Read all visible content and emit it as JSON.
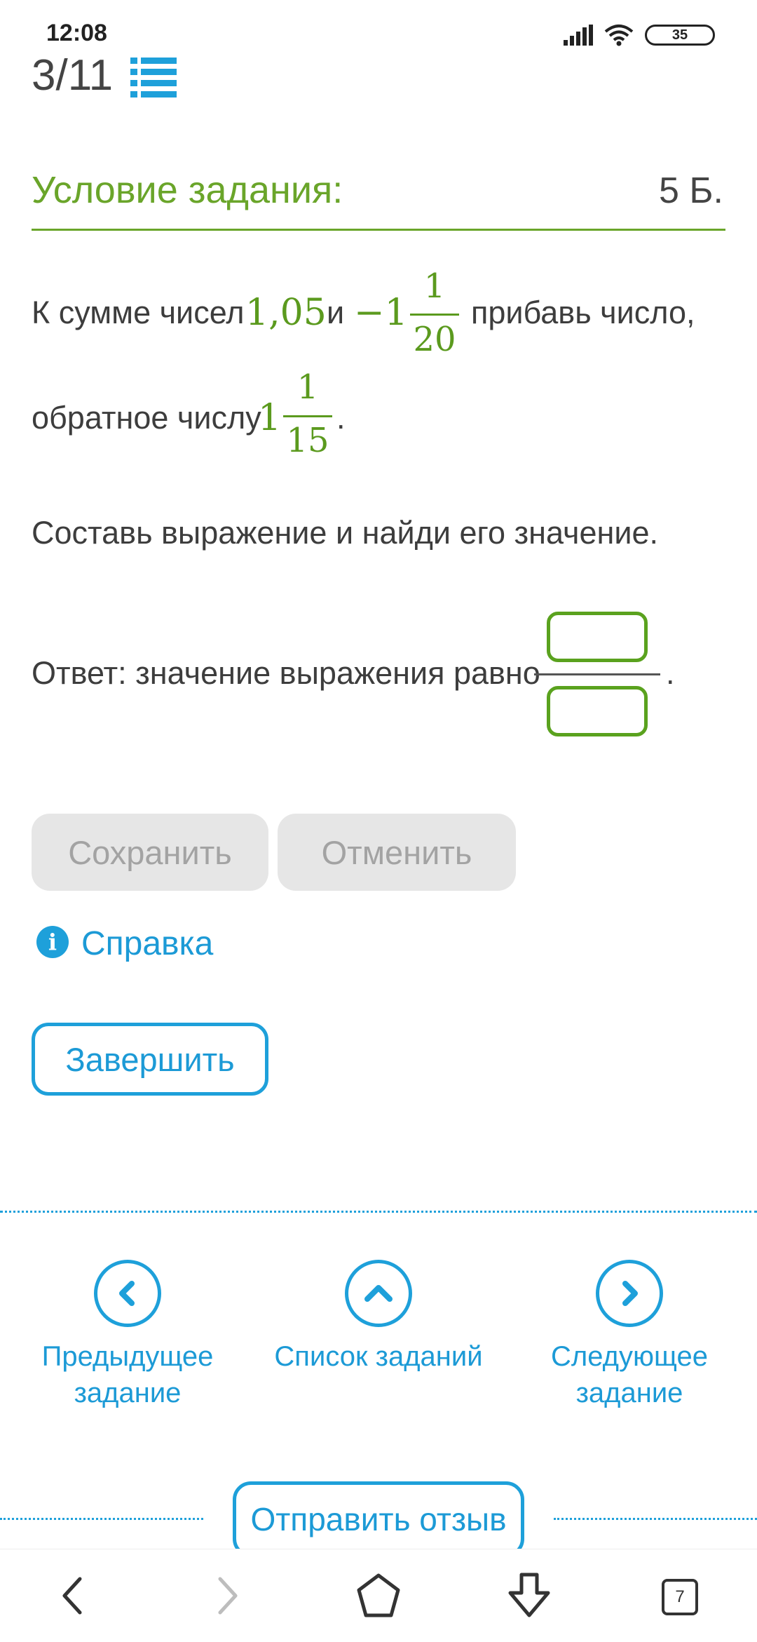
{
  "status_bar": {
    "time": "12:08",
    "battery": "35"
  },
  "header": {
    "counter": "3/11"
  },
  "task": {
    "title": "Условие задания:",
    "points": "5 Б.",
    "line1_prefix": "К сумме чисел",
    "num_a": "1,05",
    "conj": "и",
    "num_b_whole": "−1",
    "num_b_numerator": "1",
    "num_b_denominator": "20",
    "line1_suffix": "прибавь число,",
    "line2_prefix": "обратное числу",
    "num_c_whole": "1",
    "num_c_numerator": "1",
    "num_c_denominator": "15",
    "line2_suffix": ".",
    "instruction": "Составь выражение и найди его значение.",
    "answer_label": "Ответ: значение выражения равно",
    "answer_suffix": ".",
    "numerator_value": "",
    "denominator_value": ""
  },
  "actions": {
    "save": "Сохранить",
    "cancel": "Отменить",
    "help": "Справка",
    "finish": "Завершить"
  },
  "navigation": {
    "prev_line1": "Предыдущее",
    "prev_line2": "задание",
    "list": "Список заданий",
    "next_line1": "Следующее",
    "next_line2": "задание"
  },
  "feedback": "Отправить отзыв",
  "system_nav": {
    "tabs_count": "7"
  },
  "colors": {
    "accent_green": "#6aa52a",
    "accent_blue": "#1ea0da",
    "button_gray": "#e6e6e6"
  }
}
